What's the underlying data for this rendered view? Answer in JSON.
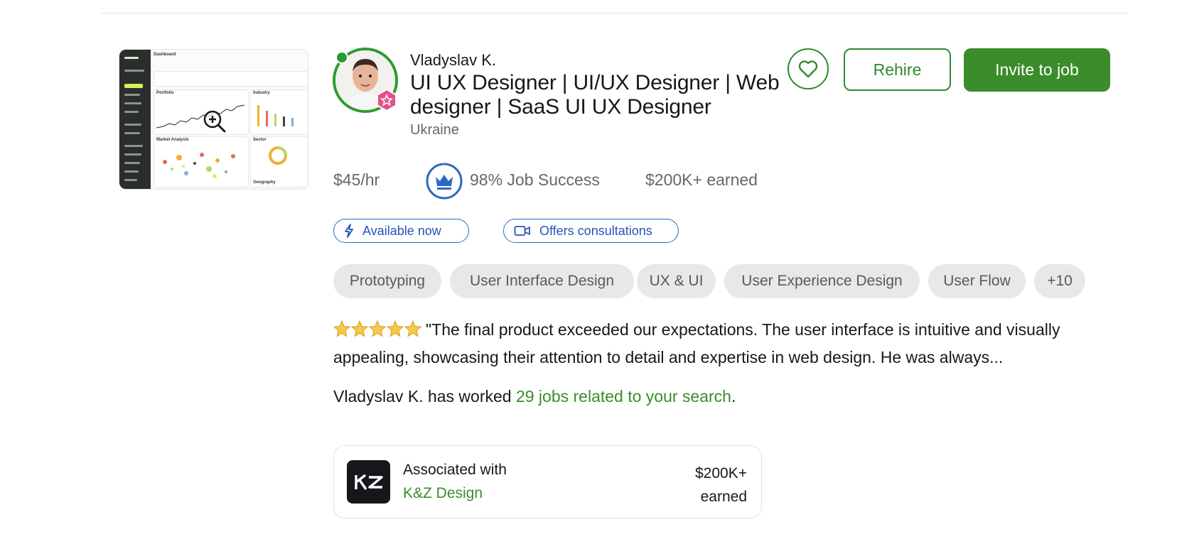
{
  "freelancer": {
    "name": "Vladyslav K.",
    "title": "UI UX Designer | UI/UX Designer | Web designer | SaaS UI UX Designer",
    "country": "Ukraine",
    "online": true,
    "rate": "$45/hr",
    "job_success": "98% Job Success",
    "job_success_percent": 98,
    "earned": "$200K+ earned"
  },
  "actions": {
    "favorite_icon": "heart-icon",
    "rehire_label": "Rehire",
    "invite_label": "Invite to job"
  },
  "badges": {
    "available": "Available now",
    "available_icon": "lightning-icon",
    "consult": "Offers consultations",
    "consult_icon": "video-camera-icon"
  },
  "skills": [
    "Prototyping",
    "User Interface Design",
    "UX & UI",
    "User Experience Design",
    "User Flow",
    "+10"
  ],
  "review": {
    "stars": 5,
    "text": "\"The final product exceeded our expectations. The user interface is intuitive and visually appealing, showcasing their attention to detail and expertise in web design. He was always..."
  },
  "worked": {
    "prefix": "Vladyslav K. has worked ",
    "link": "29 jobs related to your search",
    "suffix": "."
  },
  "association": {
    "label": "Associated with",
    "agency": "K&Z Design",
    "earned_line1": "$200K+",
    "earned_line2": "earned"
  },
  "colors": {
    "brand_green": "#3b8c2a",
    "badge_blue": "#2654b5",
    "top_rated_pink": "#e6508a"
  },
  "thumbnail": {
    "header": "Dashboard",
    "panels": [
      "Portfolio",
      "Industry",
      "Market Analysis",
      "Sector",
      "Geography"
    ]
  }
}
